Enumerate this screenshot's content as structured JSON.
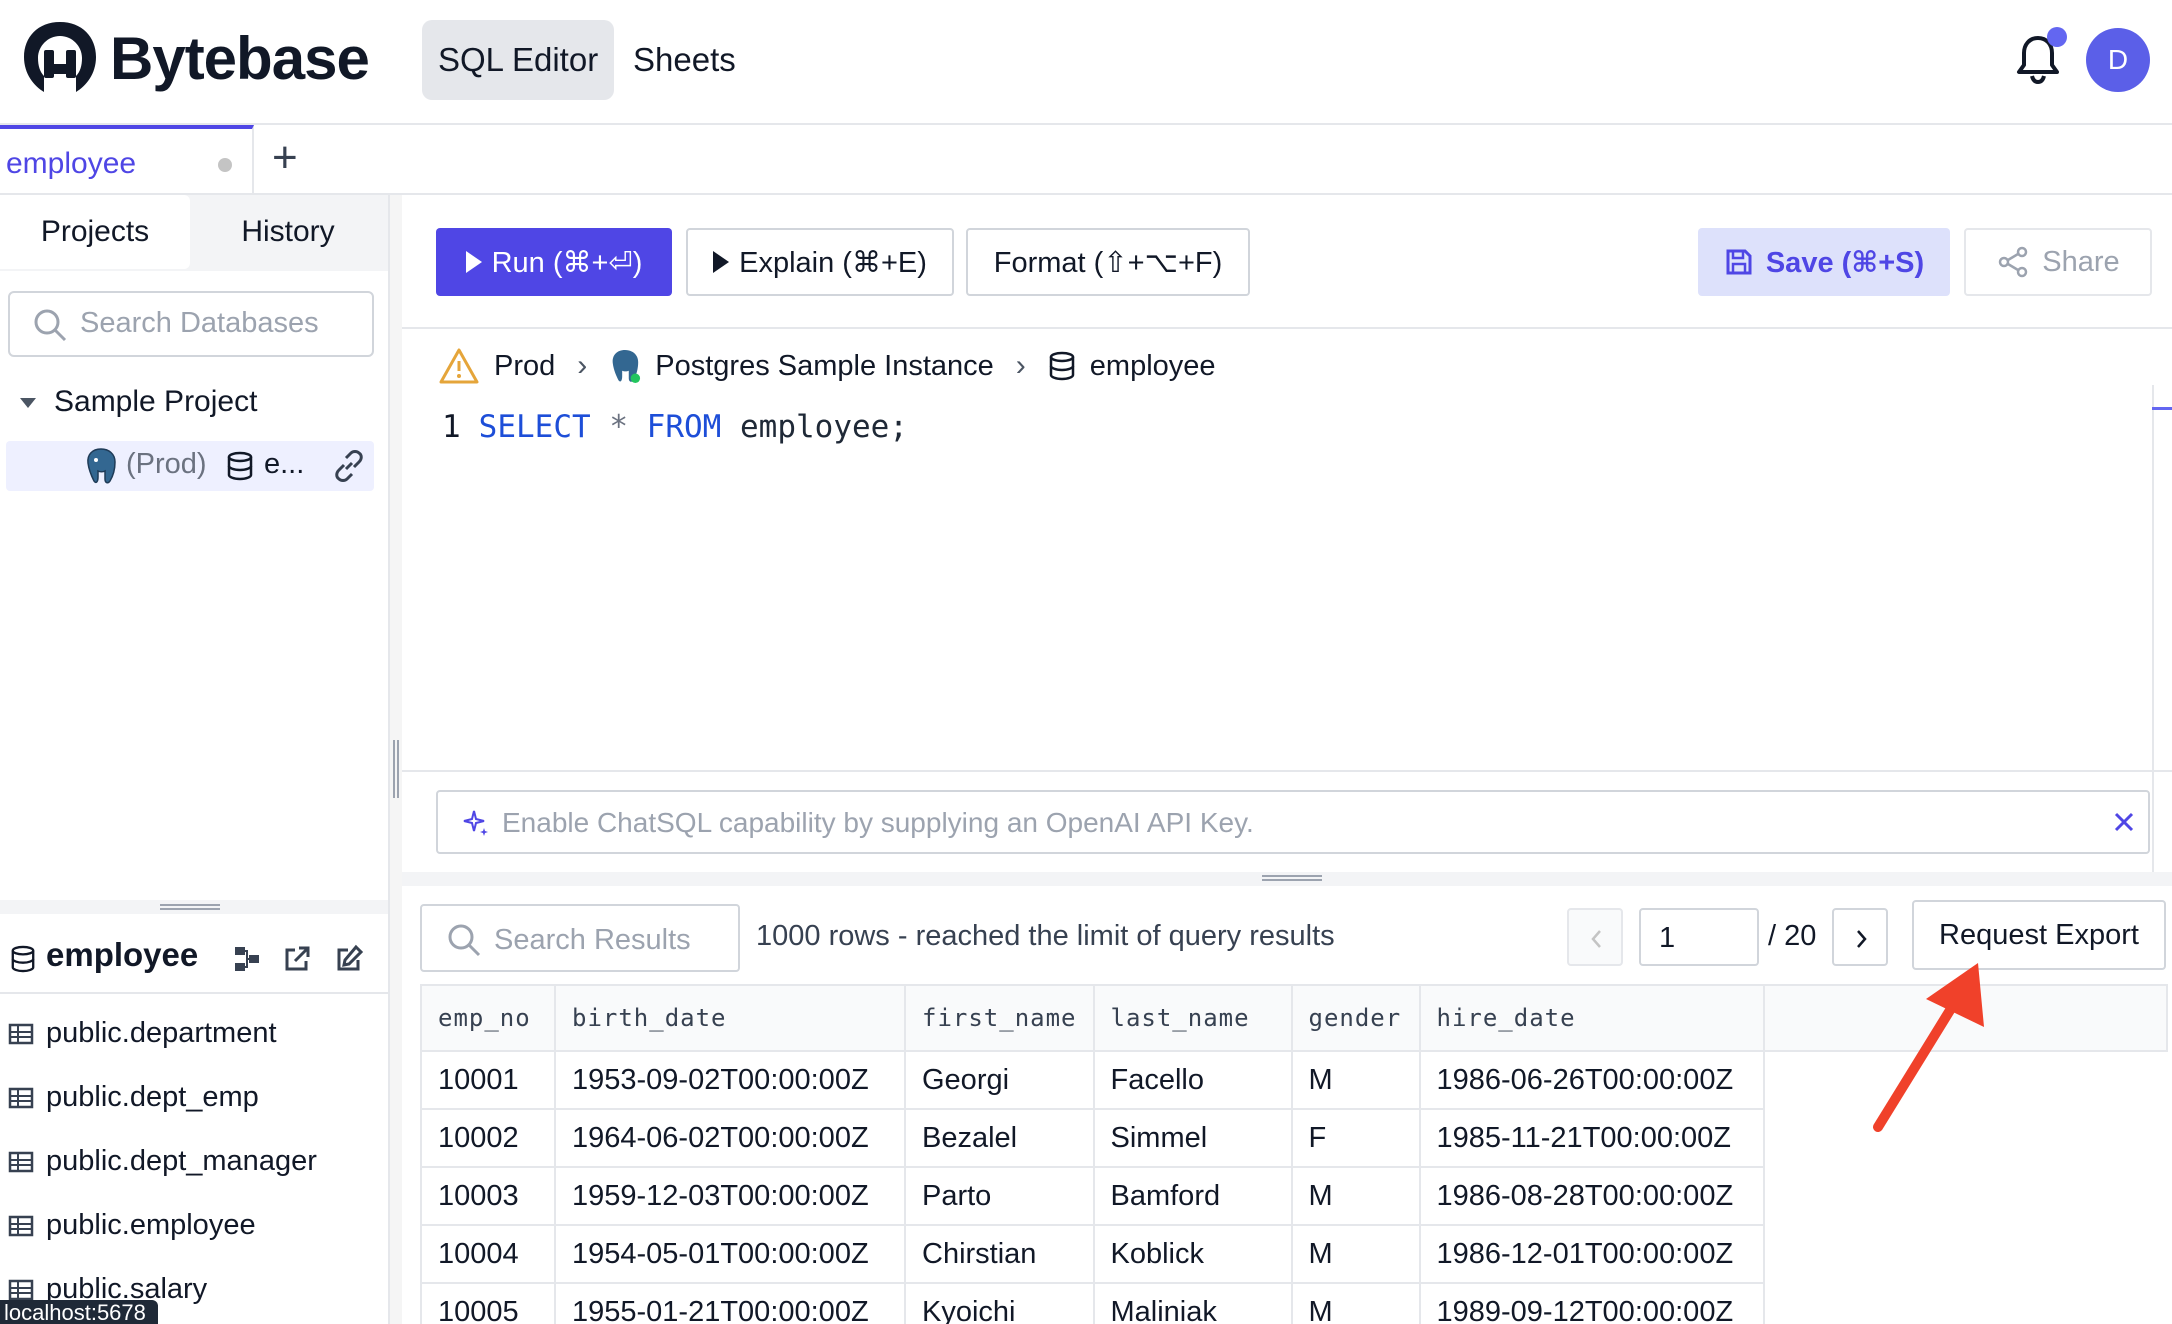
{
  "header": {
    "brand": "Bytebase",
    "nav": {
      "sql_editor": "SQL Editor",
      "sheets": "Sheets"
    },
    "avatar_initial": "D",
    "accent_color": "#4f46e5"
  },
  "tabs": [
    {
      "label": "employee"
    }
  ],
  "sidebar": {
    "tabs": {
      "projects": "Projects",
      "history": "History"
    },
    "search_placeholder": "Search Databases",
    "project_name": "Sample Project",
    "db_item": {
      "env": "(Prod)",
      "name": "e..."
    },
    "schema": {
      "title": "employee",
      "tables": [
        "public.department",
        "public.dept_emp",
        "public.dept_manager",
        "public.employee",
        "public.salary"
      ]
    },
    "status_url": "localhost:5678"
  },
  "toolbar": {
    "run": "Run (⌘+⏎)",
    "explain": "Explain (⌘+E)",
    "format": "Format (⇧+⌥+F)",
    "save": "Save (⌘+S)",
    "share": "Share"
  },
  "breadcrumb": {
    "env": "Prod",
    "instance": "Postgres Sample Instance",
    "database": "employee"
  },
  "editor": {
    "line_no": "1",
    "kw_select": "SELECT",
    "star": "*",
    "kw_from": "FROM",
    "rest": "employee;"
  },
  "chat": {
    "placeholder": "Enable ChatSQL capability by supplying an OpenAI API Key."
  },
  "results": {
    "search_placeholder": "Search Results",
    "info": "1000 rows  -  reached the limit of query results",
    "page": "1",
    "total_pages": "/ 20",
    "export_label": "Request Export",
    "columns": [
      "emp_no",
      "birth_date",
      "first_name",
      "last_name",
      "gender",
      "hire_date"
    ],
    "rows": [
      [
        "10001",
        "1953-09-02T00:00:00Z",
        "Georgi",
        "Facello",
        "M",
        "1986-06-26T00:00:00Z"
      ],
      [
        "10002",
        "1964-06-02T00:00:00Z",
        "Bezalel",
        "Simmel",
        "F",
        "1985-11-21T00:00:00Z"
      ],
      [
        "10003",
        "1959-12-03T00:00:00Z",
        "Parto",
        "Bamford",
        "M",
        "1986-08-28T00:00:00Z"
      ],
      [
        "10004",
        "1954-05-01T00:00:00Z",
        "Chirstian",
        "Koblick",
        "M",
        "1986-12-01T00:00:00Z"
      ],
      [
        "10005",
        "1955-01-21T00:00:00Z",
        "Kyoichi",
        "Maliniak",
        "M",
        "1989-09-12T00:00:00Z"
      ]
    ]
  }
}
